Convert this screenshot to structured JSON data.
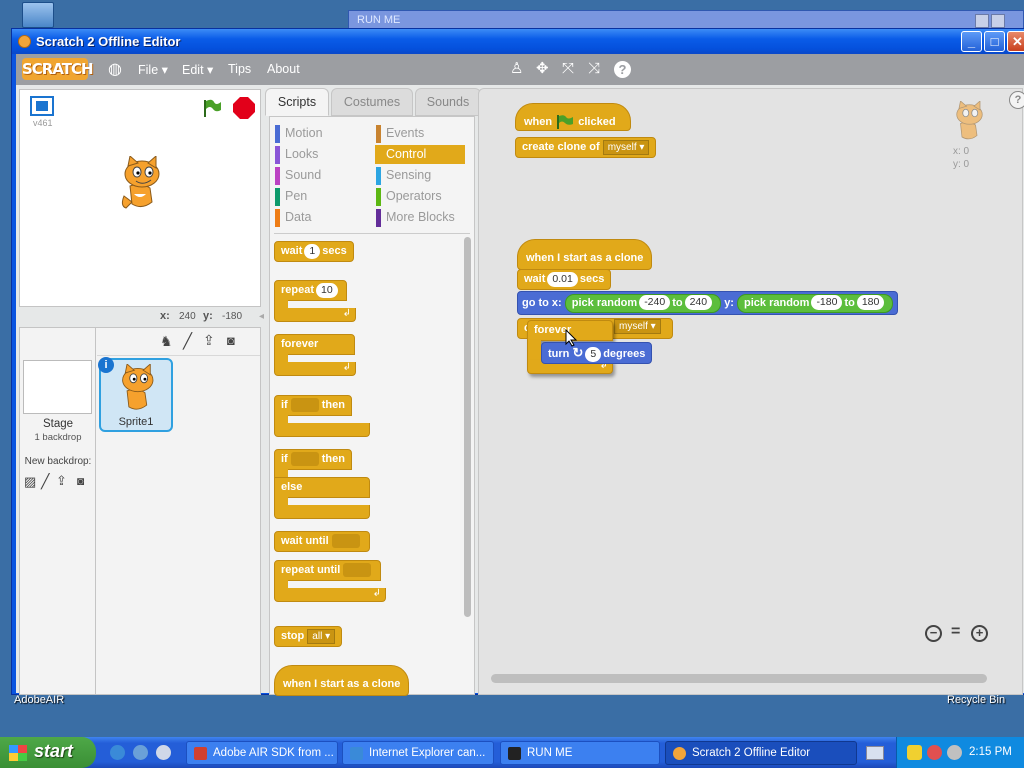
{
  "desktop": {
    "bottom_left_label": "AdobeAIR",
    "recycle_label": "Recycle Bin",
    "bg_window_title": "RUN ME"
  },
  "window": {
    "title": "Scratch 2 Offline Editor",
    "min": "_",
    "max": "□",
    "close": "✕"
  },
  "menubar": {
    "logo": "SCRATCH",
    "items": [
      "File ▾",
      "Edit ▾",
      "Tips",
      "About"
    ],
    "tools": {
      "duplicate": "♙",
      "cut": "✥",
      "grow": "⤧",
      "shrink": "⤨",
      "help": "?"
    }
  },
  "stage": {
    "version": "v461",
    "x_label": "x:",
    "x_value": "240",
    "y_label": "y:",
    "y_value": "-180"
  },
  "sprites": {
    "stage_label": "Stage",
    "stage_sub": "1 backdrop",
    "new_backdrop": "New backdrop:",
    "sprite_name": "Sprite1",
    "info": "i"
  },
  "tabs": [
    "Scripts",
    "Costumes",
    "Sounds"
  ],
  "categories": {
    "left": [
      {
        "label": "Motion",
        "color": "#4a6cd4"
      },
      {
        "label": "Looks",
        "color": "#8a55d7"
      },
      {
        "label": "Sound",
        "color": "#bb42c3"
      },
      {
        "label": "Pen",
        "color": "#0e9a6c"
      },
      {
        "label": "Data",
        "color": "#ee7d16"
      }
    ],
    "right": [
      {
        "label": "Events",
        "color": "#c88330"
      },
      {
        "label": "Control",
        "color": "#e1a91a"
      },
      {
        "label": "Sensing",
        "color": "#2ca5e2"
      },
      {
        "label": "Operators",
        "color": "#5cb712"
      },
      {
        "label": "More Blocks",
        "color": "#632d99"
      }
    ]
  },
  "palette_blocks": {
    "wait": "wait",
    "wait_val": "1",
    "secs": "secs",
    "repeat": "repeat",
    "repeat_val": "10",
    "forever": "forever",
    "if": "if",
    "then": "then",
    "else": "else",
    "wait_until": "wait until",
    "repeat_until": "repeat until",
    "stop": "stop",
    "stop_val": "all",
    "clone_hat": "when I start as a clone"
  },
  "script1": {
    "when": "when",
    "clicked": "clicked",
    "create_clone": "create clone of",
    "target": "myself"
  },
  "script2": {
    "hat": "when I start as a clone",
    "wait": "wait",
    "wait_val": "0.01",
    "secs": "secs",
    "goto": "go to x:",
    "pick_random": "pick random",
    "x_from": "-240",
    "to": "to",
    "x_to": "240",
    "y_label": "y:",
    "y_from": "-180",
    "y_to": "180",
    "forever": "forever",
    "clone_target": "myself",
    "turn": "turn",
    "turn_val": "5",
    "degrees": "degrees"
  },
  "sprite_info": {
    "x": "x: 0",
    "y": "y: 0"
  },
  "zoom": {
    "out": "−",
    "reset": "=",
    "in": "+"
  },
  "taskbar": {
    "start": "start",
    "tasks": [
      {
        "label": "Adobe AIR SDK from ...",
        "color": "#d04030"
      },
      {
        "label": "Internet Explorer can...",
        "color": "#3a8ad8"
      },
      {
        "label": "RUN ME",
        "color": "#222222"
      },
      {
        "label": "Scratch 2 Offline Editor",
        "color": "#f3a53a"
      }
    ],
    "clock": "2:15 PM"
  }
}
